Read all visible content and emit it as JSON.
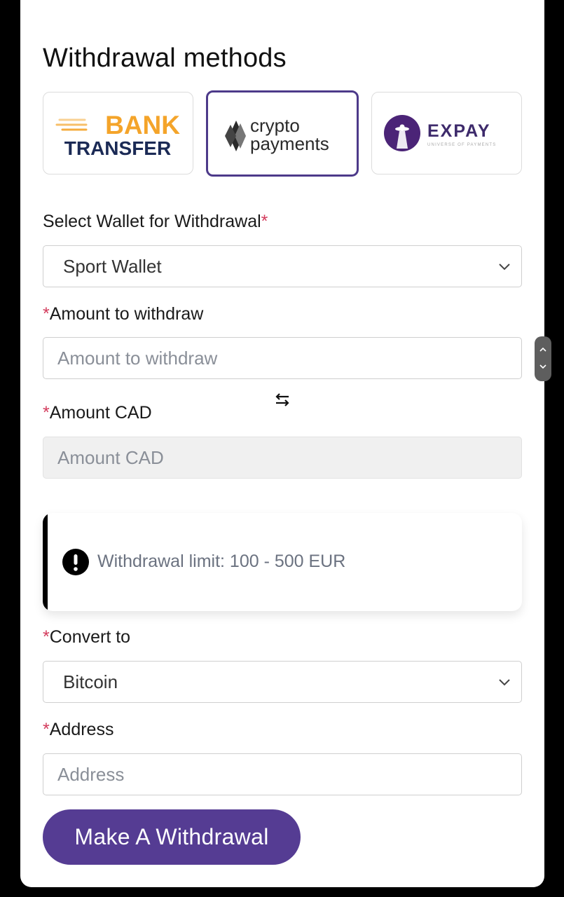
{
  "title": "Withdrawal methods",
  "methods": [
    {
      "name": "bank-transfer",
      "line1": "BANK",
      "line2": "TRANSFER",
      "selected": false
    },
    {
      "name": "crypto-payments",
      "line1": "crypto",
      "line2": "payments",
      "selected": true
    },
    {
      "name": "expay",
      "text": "EXPAY",
      "tagline": "UNIVERSE OF PAYMENTS",
      "selected": false
    }
  ],
  "wallet": {
    "label": "Select Wallet for Withdrawal",
    "required_mark": "*",
    "value": "Sport Wallet"
  },
  "amount": {
    "required_mark": "*",
    "label": "Amount to withdraw",
    "placeholder": "Amount to withdraw"
  },
  "amount_cad": {
    "required_mark": "*",
    "label": "Amount CAD",
    "placeholder": "Amount CAD"
  },
  "notice": {
    "text": "Withdrawal limit: 100 - 500 EUR"
  },
  "convert": {
    "required_mark": "*",
    "label": "Convert to",
    "value": "Bitcoin"
  },
  "address": {
    "required_mark": "*",
    "label": "Address",
    "placeholder": "Address"
  },
  "submit_label": "Make A Withdrawal",
  "colors": {
    "accent": "#553c93",
    "selected_border": "#4d3a8a",
    "required": "#d33b5c",
    "bank_orange": "#f4a42a",
    "bank_navy": "#1b2a55"
  }
}
